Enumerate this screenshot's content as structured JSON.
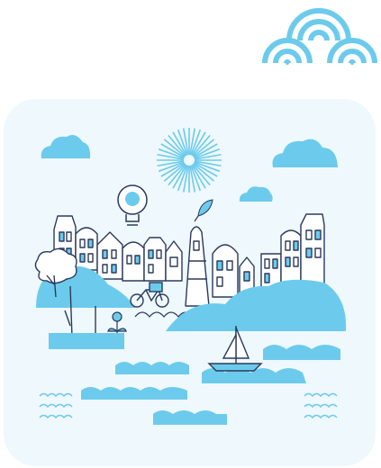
{
  "colors": {
    "background": "#ffffff",
    "card": "#eef8fd",
    "fill": "#6ccbec",
    "line": "#2b3a5c",
    "light": "#ffffff"
  },
  "icons": [
    "logo-arches-icon",
    "sun-icon",
    "lightbulb-icon",
    "bicycle-icon",
    "sailboat-icon",
    "flower-icon",
    "tree-icon",
    "cloud-icon",
    "wave-icon"
  ]
}
